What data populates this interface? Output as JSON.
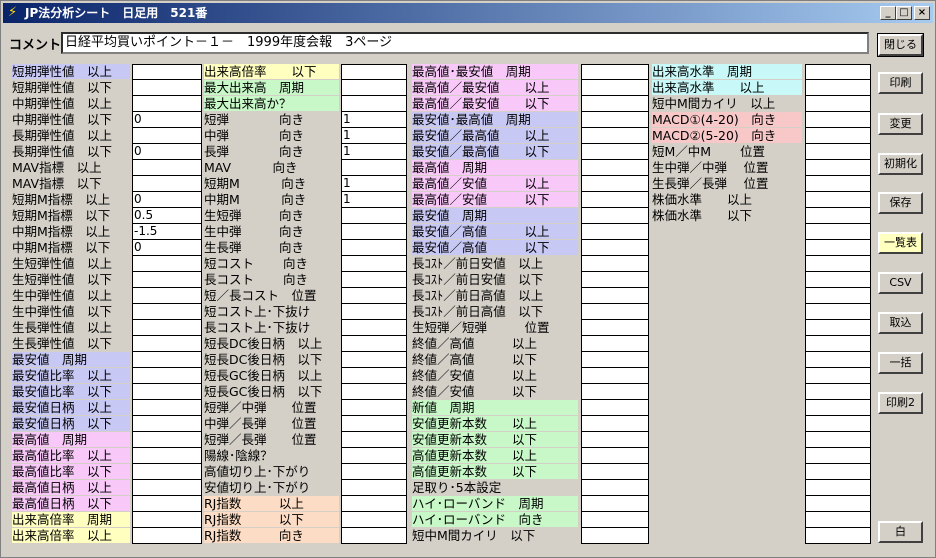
{
  "window": {
    "title": "JP法分析シート　日足用　521番",
    "minimize": "_",
    "maximize": "□",
    "close": "×"
  },
  "comment": {
    "label": "コメント",
    "value": "日経平均買いポイント－１－　1999年度会報　3ページ"
  },
  "buttons": {
    "close": "閉じる",
    "print": "印刷",
    "change": "変更",
    "init": "初期化",
    "save": "保存",
    "list": "一覧表",
    "csv": "CSV",
    "import": "取込",
    "batch": "一括",
    "print2": "印刷2",
    "white": "白"
  },
  "colors": {
    "blue": "#c8c8f4",
    "pink": "#f8c8f8",
    "yellow": "#ffffc0",
    "green": "#c8f8c8",
    "orange": "#fcdcc4",
    "salmon": "#f8c8c8",
    "cyan": "#c8f8f8"
  },
  "columns": [
    {
      "rows": [
        {
          "label": "短期弾性値　以上",
          "color": "blue",
          "value": ""
        },
        {
          "label": "短期弾性値　以下",
          "color": "",
          "value": ""
        },
        {
          "label": "中期弾性値　以上",
          "color": "",
          "value": ""
        },
        {
          "label": "中期弾性値　以下",
          "color": "",
          "value": "0"
        },
        {
          "label": "長期弾性値　以上",
          "color": "",
          "value": ""
        },
        {
          "label": "長期弾性値　以下",
          "color": "",
          "value": "0"
        },
        {
          "label": "MAV指標　以上",
          "color": "",
          "value": ""
        },
        {
          "label": "MAV指標　以下",
          "color": "",
          "value": ""
        },
        {
          "label": "短期M指標　以上",
          "color": "",
          "value": "0"
        },
        {
          "label": "短期M指標　以下",
          "color": "",
          "value": "0.5"
        },
        {
          "label": "中期M指標　以上",
          "color": "",
          "value": "-1.5"
        },
        {
          "label": "中期M指標　以下",
          "color": "",
          "value": "0"
        },
        {
          "label": "生短弾性値　以上",
          "color": "",
          "value": ""
        },
        {
          "label": "生短弾性値　以下",
          "color": "",
          "value": ""
        },
        {
          "label": "生中弾性値　以上",
          "color": "",
          "value": ""
        },
        {
          "label": "生中弾性値　以下",
          "color": "",
          "value": ""
        },
        {
          "label": "生長弾性値　以上",
          "color": "",
          "value": ""
        },
        {
          "label": "生長弾性値　以下",
          "color": "",
          "value": ""
        },
        {
          "label": "最安値　周期",
          "color": "blue",
          "value": ""
        },
        {
          "label": "最安値比率　以上",
          "color": "blue",
          "value": ""
        },
        {
          "label": "最安値比率　以下",
          "color": "blue",
          "value": ""
        },
        {
          "label": "最安値日柄　以上",
          "color": "blue",
          "value": ""
        },
        {
          "label": "最安値日柄　以下",
          "color": "blue",
          "value": ""
        },
        {
          "label": "最高値　周期",
          "color": "pink",
          "value": ""
        },
        {
          "label": "最高値比率　以上",
          "color": "pink",
          "value": ""
        },
        {
          "label": "最高値比率　以下",
          "color": "pink",
          "value": ""
        },
        {
          "label": "最高値日柄　以上",
          "color": "pink",
          "value": ""
        },
        {
          "label": "最高値日柄　以下",
          "color": "pink",
          "value": ""
        },
        {
          "label": "出来高倍率　周期",
          "color": "yellow",
          "value": ""
        },
        {
          "label": "出来高倍率　以上",
          "color": "yellow",
          "value": ""
        }
      ]
    },
    {
      "rows": [
        {
          "label": "出来高倍率　　以下",
          "color": "yellow",
          "value": ""
        },
        {
          "label": "最大出来高　周期",
          "color": "green",
          "value": ""
        },
        {
          "label": "最大出来高か？",
          "color": "green",
          "value": ""
        },
        {
          "label": "短弾　　　　向き",
          "color": "",
          "value": "1"
        },
        {
          "label": "中弾　　　　向き",
          "color": "",
          "value": "1"
        },
        {
          "label": "長弾　　　　向き",
          "color": "",
          "value": "1"
        },
        {
          "label": "MAV　　　 向き",
          "color": "",
          "value": ""
        },
        {
          "label": "短期M　　　 向き",
          "color": "",
          "value": "1"
        },
        {
          "label": "中期M　　　 向き",
          "color": "",
          "value": "1"
        },
        {
          "label": "生短弾　　　向き",
          "color": "",
          "value": ""
        },
        {
          "label": "生中弾　　　向き",
          "color": "",
          "value": ""
        },
        {
          "label": "生長弾　　　向き",
          "color": "",
          "value": ""
        },
        {
          "label": "短コスト　　 向き",
          "color": "",
          "value": ""
        },
        {
          "label": "長コスト　　 向き",
          "color": "",
          "value": ""
        },
        {
          "label": "短／長コスト　位置",
          "color": "",
          "value": ""
        },
        {
          "label": "短コスト上･下抜け",
          "color": "",
          "value": ""
        },
        {
          "label": "長コスト上･下抜け",
          "color": "",
          "value": ""
        },
        {
          "label": "短長DC後日柄　以上",
          "color": "",
          "value": ""
        },
        {
          "label": "短長DC後日柄　以下",
          "color": "",
          "value": ""
        },
        {
          "label": "短長GC後日柄　以上",
          "color": "",
          "value": ""
        },
        {
          "label": "短長GC後日柄　以下",
          "color": "",
          "value": ""
        },
        {
          "label": "短弾／中弾　　位置",
          "color": "",
          "value": ""
        },
        {
          "label": "中弾／長弾　　位置",
          "color": "",
          "value": ""
        },
        {
          "label": "短弾／長弾　　位置",
          "color": "",
          "value": ""
        },
        {
          "label": "陽線･陰線？",
          "color": "",
          "value": ""
        },
        {
          "label": "高値切り上･下がり",
          "color": "",
          "value": ""
        },
        {
          "label": "安値切り上･下がり",
          "color": "",
          "value": ""
        },
        {
          "label": "RJ指数　　　以上",
          "color": "orange",
          "value": ""
        },
        {
          "label": "RJ指数　　　以下",
          "color": "orange",
          "value": ""
        },
        {
          "label": "RJ指数　　　向き",
          "color": "orange",
          "value": ""
        }
      ]
    },
    {
      "rows": [
        {
          "label": "最高値･最安値　周期",
          "color": "pink",
          "value": ""
        },
        {
          "label": "最高値／最安値　　以上",
          "color": "pink",
          "value": ""
        },
        {
          "label": "最高値／最安値　　以下",
          "color": "pink",
          "value": ""
        },
        {
          "label": "最安値･最高値　周期",
          "color": "blue",
          "value": ""
        },
        {
          "label": "最安値／最高値　　以上",
          "color": "blue",
          "value": ""
        },
        {
          "label": "最安値／最高値　　以下",
          "color": "blue",
          "value": ""
        },
        {
          "label": "最高値　周期",
          "color": "pink",
          "value": ""
        },
        {
          "label": "最高値／安値　　　以上",
          "color": "pink",
          "value": ""
        },
        {
          "label": "最高値／安値　　　以下",
          "color": "pink",
          "value": ""
        },
        {
          "label": "最安値　周期",
          "color": "blue",
          "value": ""
        },
        {
          "label": "最安値／高値　　　以上",
          "color": "blue",
          "value": ""
        },
        {
          "label": "最安値／高値　　　以下",
          "color": "blue",
          "value": ""
        },
        {
          "label": "長ｺｽﾄ／前日安値　以上",
          "color": "",
          "value": ""
        },
        {
          "label": "長ｺｽﾄ／前日安値　以下",
          "color": "",
          "value": ""
        },
        {
          "label": "長ｺｽﾄ／前日高値　以上",
          "color": "",
          "value": ""
        },
        {
          "label": "長ｺｽﾄ／前日高値　以下",
          "color": "",
          "value": ""
        },
        {
          "label": "生短弾／短弾　　　位置",
          "color": "",
          "value": ""
        },
        {
          "label": "終値／高値　　　以上",
          "color": "",
          "value": ""
        },
        {
          "label": "終値／高値　　　以下",
          "color": "",
          "value": ""
        },
        {
          "label": "終値／安値　　　以上",
          "color": "",
          "value": ""
        },
        {
          "label": "終値／安値　　　以下",
          "color": "",
          "value": ""
        },
        {
          "label": "新値　周期",
          "color": "green",
          "value": ""
        },
        {
          "label": "安値更新本数　　以上",
          "color": "green",
          "value": ""
        },
        {
          "label": "安値更新本数　　以下",
          "color": "green",
          "value": ""
        },
        {
          "label": "高値更新本数　　以上",
          "color": "green",
          "value": ""
        },
        {
          "label": "高値更新本数　　以下",
          "color": "green",
          "value": ""
        },
        {
          "label": "足取り･5本設定",
          "color": "",
          "value": ""
        },
        {
          "label": "ハイ･ローバンド　周期",
          "color": "green",
          "value": ""
        },
        {
          "label": "ハイ･ローバンド　向き",
          "color": "green",
          "value": ""
        },
        {
          "label": "短中M間カイリ　以下",
          "color": "",
          "value": ""
        }
      ]
    },
    {
      "rows": [
        {
          "label": "出来高水準　周期",
          "color": "cyan",
          "value": ""
        },
        {
          "label": "出来高水準　　以上",
          "color": "cyan",
          "value": ""
        },
        {
          "label": "短中M間カイリ　以上",
          "color": "",
          "value": ""
        },
        {
          "label": "MACD①(4-20)　向き",
          "color": "salmon",
          "value": ""
        },
        {
          "label": "MACD②(5-20)　向き",
          "color": "salmon",
          "value": ""
        },
        {
          "label": "短M／中M　　 位置",
          "color": "",
          "value": ""
        },
        {
          "label": "生中弾／中弾　 位置",
          "color": "",
          "value": ""
        },
        {
          "label": "生長弾／長弾　 位置",
          "color": "",
          "value": ""
        },
        {
          "label": "株価水準　　以上",
          "color": "",
          "value": ""
        },
        {
          "label": "株価水準　　以下",
          "color": "",
          "value": ""
        },
        {
          "label": "",
          "color": "",
          "value": ""
        },
        {
          "label": "",
          "color": "",
          "value": ""
        },
        {
          "label": "",
          "color": "",
          "value": ""
        },
        {
          "label": "",
          "color": "",
          "value": ""
        },
        {
          "label": "",
          "color": "",
          "value": ""
        },
        {
          "label": "",
          "color": "",
          "value": ""
        },
        {
          "label": "",
          "color": "",
          "value": ""
        },
        {
          "label": "",
          "color": "",
          "value": ""
        },
        {
          "label": "",
          "color": "",
          "value": ""
        },
        {
          "label": "",
          "color": "",
          "value": ""
        },
        {
          "label": "",
          "color": "",
          "value": ""
        },
        {
          "label": "",
          "color": "",
          "value": ""
        },
        {
          "label": "",
          "color": "",
          "value": ""
        },
        {
          "label": "",
          "color": "",
          "value": ""
        },
        {
          "label": "",
          "color": "",
          "value": ""
        },
        {
          "label": "",
          "color": "",
          "value": ""
        },
        {
          "label": "",
          "color": "",
          "value": ""
        },
        {
          "label": "",
          "color": "",
          "value": ""
        },
        {
          "label": "",
          "color": "",
          "value": ""
        },
        {
          "label": "",
          "color": "",
          "value": ""
        }
      ]
    }
  ]
}
